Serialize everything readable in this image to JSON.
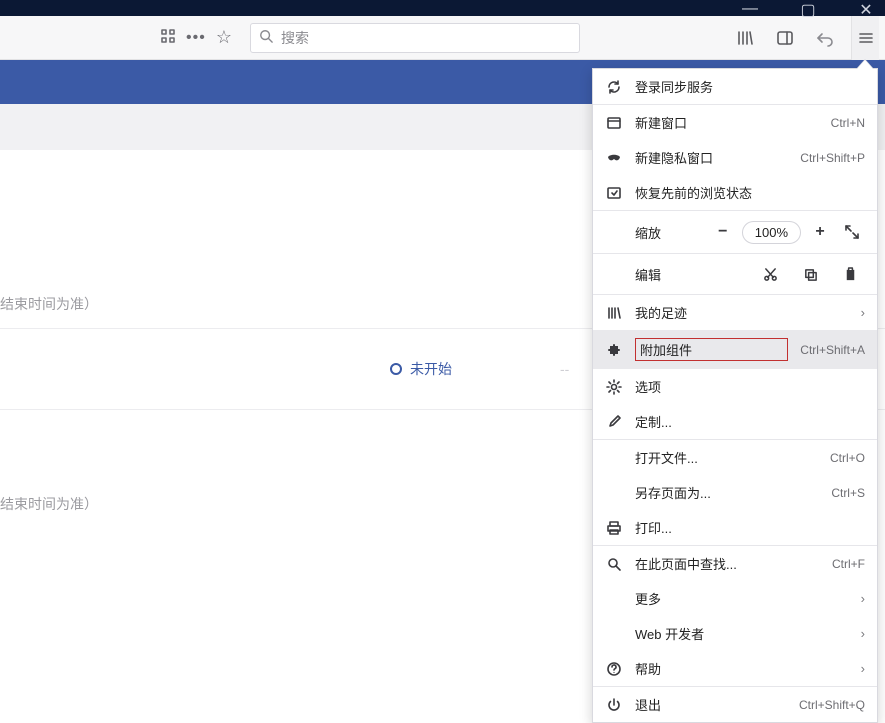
{
  "titlebar": {
    "minimize": "—",
    "maximize": "▢",
    "close": "✕"
  },
  "toolbar": {
    "search_placeholder": "搜索"
  },
  "page": {
    "faint_text_1": "结束时间为准）",
    "status_label": "未开始",
    "status_dash": "--",
    "faint_text_2": "结束时间为准）"
  },
  "menu": {
    "sync_login": "登录同步服务",
    "new_window": {
      "label": "新建窗口",
      "shortcut": "Ctrl+N"
    },
    "new_private": {
      "label": "新建隐私窗口",
      "shortcut": "Ctrl+Shift+P"
    },
    "restore_session": "恢复先前的浏览状态",
    "zoom_label": "缩放",
    "zoom_value": "100%",
    "edit_label": "编辑",
    "library": "我的足迹",
    "addons": {
      "label": "附加组件",
      "shortcut": "Ctrl+Shift+A"
    },
    "options": "选项",
    "customize": "定制...",
    "open_file": {
      "label": "打开文件...",
      "shortcut": "Ctrl+O"
    },
    "save_as": {
      "label": "另存页面为...",
      "shortcut": "Ctrl+S"
    },
    "print": "打印...",
    "find": {
      "label": "在此页面中查找...",
      "shortcut": "Ctrl+F"
    },
    "more": "更多",
    "web_dev": "Web 开发者",
    "help": "帮助",
    "quit": {
      "label": "退出",
      "shortcut": "Ctrl+Shift+Q"
    }
  }
}
